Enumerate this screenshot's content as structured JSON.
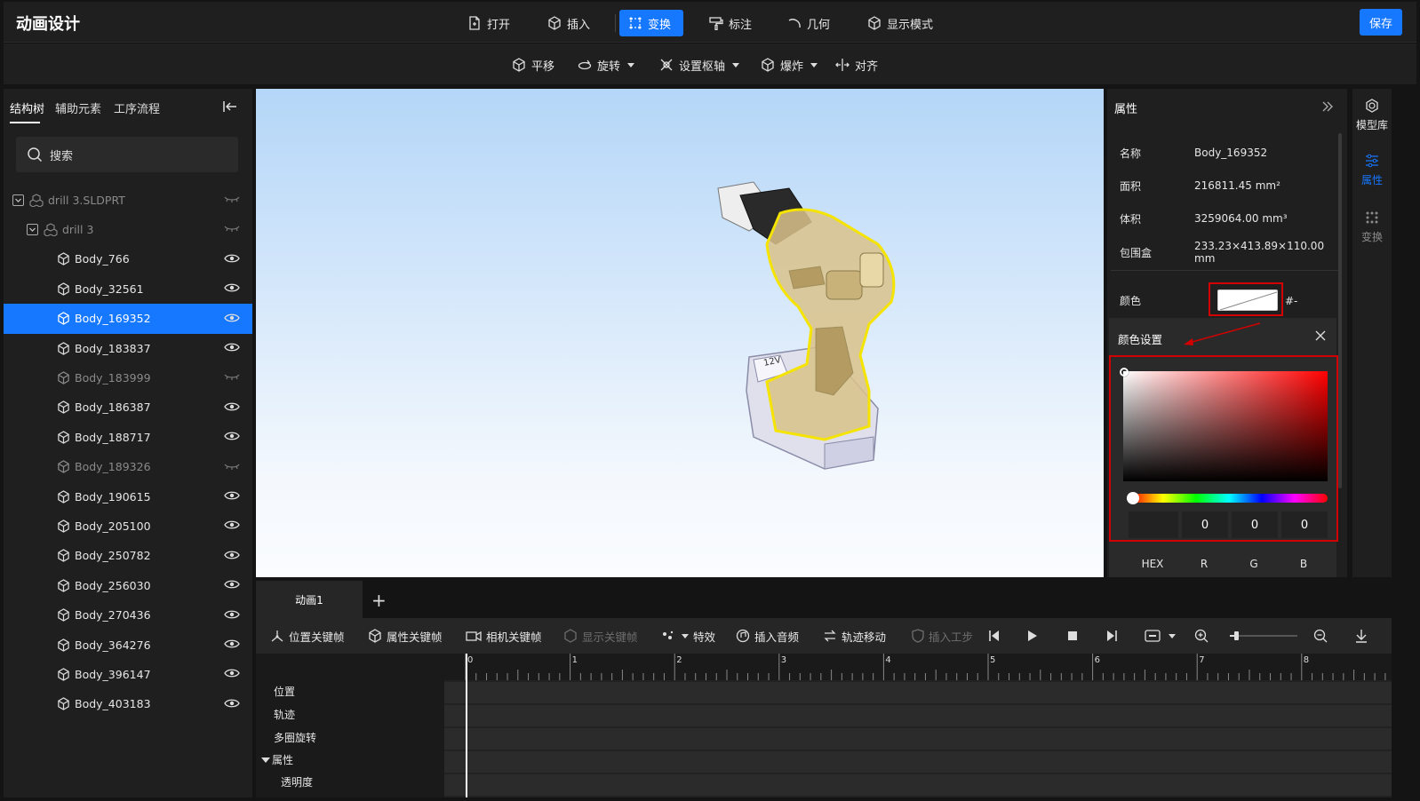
{
  "header": {
    "title": "动画设计",
    "buttons": [
      {
        "label": "打开",
        "icon": "file-open-icon"
      },
      {
        "label": "插入",
        "icon": "cube-insert-icon"
      },
      {
        "label": "变换",
        "icon": "transform-icon",
        "active": true
      },
      {
        "label": "标注",
        "icon": "paint-roller-icon"
      },
      {
        "label": "几何",
        "icon": "arc-icon"
      },
      {
        "label": "显示模式",
        "icon": "cube-display-icon"
      }
    ],
    "save_label": "保存"
  },
  "subbar": {
    "buttons": [
      {
        "label": "平移",
        "icon": "move-cube-icon",
        "dropdown": false
      },
      {
        "label": "旋转",
        "icon": "rotate-icon",
        "dropdown": true
      },
      {
        "label": "设置枢轴",
        "icon": "pivot-icon",
        "dropdown": true
      },
      {
        "label": "爆炸",
        "icon": "explode-icon",
        "dropdown": true
      },
      {
        "label": "对齐",
        "icon": "align-icon",
        "dropdown": false
      }
    ]
  },
  "left_panel": {
    "tabs": [
      "结构树",
      "辅助元素",
      "工序流程"
    ],
    "active_tab": "结构树",
    "search_placeholder": "搜索",
    "tree": [
      {
        "label": "drill 3.SLDPRT",
        "level": 0,
        "visible": false,
        "expanded": true,
        "type": "assembly"
      },
      {
        "label": "drill 3",
        "level": 1,
        "visible": false,
        "expanded": true,
        "type": "assembly"
      },
      {
        "label": "Body_766",
        "level": 2,
        "visible": true
      },
      {
        "label": "Body_32561",
        "level": 2,
        "visible": true
      },
      {
        "label": "Body_169352",
        "level": 2,
        "visible": true,
        "selected": true
      },
      {
        "label": "Body_183837",
        "level": 2,
        "visible": true
      },
      {
        "label": "Body_183999",
        "level": 2,
        "visible": false
      },
      {
        "label": "Body_186387",
        "level": 2,
        "visible": true
      },
      {
        "label": "Body_188717",
        "level": 2,
        "visible": true
      },
      {
        "label": "Body_189326",
        "level": 2,
        "visible": false
      },
      {
        "label": "Body_190615",
        "level": 2,
        "visible": true
      },
      {
        "label": "Body_205100",
        "level": 2,
        "visible": true
      },
      {
        "label": "Body_250782",
        "level": 2,
        "visible": true
      },
      {
        "label": "Body_256030",
        "level": 2,
        "visible": true
      },
      {
        "label": "Body_270436",
        "level": 2,
        "visible": true
      },
      {
        "label": "Body_364276",
        "level": 2,
        "visible": true
      },
      {
        "label": "Body_396147",
        "level": 2,
        "visible": true
      },
      {
        "label": "Body_403183",
        "level": 2,
        "visible": true
      }
    ]
  },
  "properties": {
    "title": "属性",
    "rows": [
      {
        "label": "名称",
        "value": "Body_169352"
      },
      {
        "label": "面积",
        "value": "216811.45 mm²"
      },
      {
        "label": "体积",
        "value": "3259064.00 mm³"
      },
      {
        "label": "包围盒",
        "value": "233.23×413.89×110.00 mm"
      }
    ],
    "color_label": "颜色",
    "color_hex_short": "#-",
    "color_setting": {
      "title": "颜色设置",
      "hex": "",
      "r": "0",
      "g": "0",
      "b": "0",
      "labels": [
        "HEX",
        "R",
        "G",
        "B"
      ]
    }
  },
  "right_rail": [
    {
      "label": "模型库",
      "icon": "model-library-icon",
      "state": "normal"
    },
    {
      "label": "属性",
      "icon": "sliders-icon",
      "state": "active"
    },
    {
      "label": "变换",
      "icon": "transform-grid-icon",
      "state": "dim"
    }
  ],
  "animation": {
    "tab_label": "动画1",
    "toolbar": [
      {
        "label": "位置关键帧",
        "icon": "position-keyframe-icon",
        "enabled": true
      },
      {
        "label": "属性关键帧",
        "icon": "property-keyframe-icon",
        "enabled": true
      },
      {
        "label": "相机关键帧",
        "icon": "camera-keyframe-icon",
        "enabled": true
      },
      {
        "label": "显示关键帧",
        "icon": "display-keyframe-icon",
        "enabled": false
      },
      {
        "label": "特效",
        "icon": "effects-icon",
        "enabled": true
      },
      {
        "label": "插入音频",
        "icon": "audio-icon",
        "enabled": true
      },
      {
        "label": "轨迹移动",
        "icon": "track-move-icon",
        "enabled": true
      },
      {
        "label": "插入工步",
        "icon": "step-shield-icon",
        "enabled": false
      }
    ],
    "tracks": [
      "位置",
      "轨迹",
      "多圈旋转",
      "属性",
      "透明度"
    ],
    "ruler_ticks": [
      "0",
      "1",
      "2",
      "3",
      "4",
      "5",
      "6",
      "7",
      "8"
    ],
    "colors": {
      "accent": "#1677ff",
      "highlight": "#d40000",
      "selection_outline": "#f5e300"
    }
  }
}
